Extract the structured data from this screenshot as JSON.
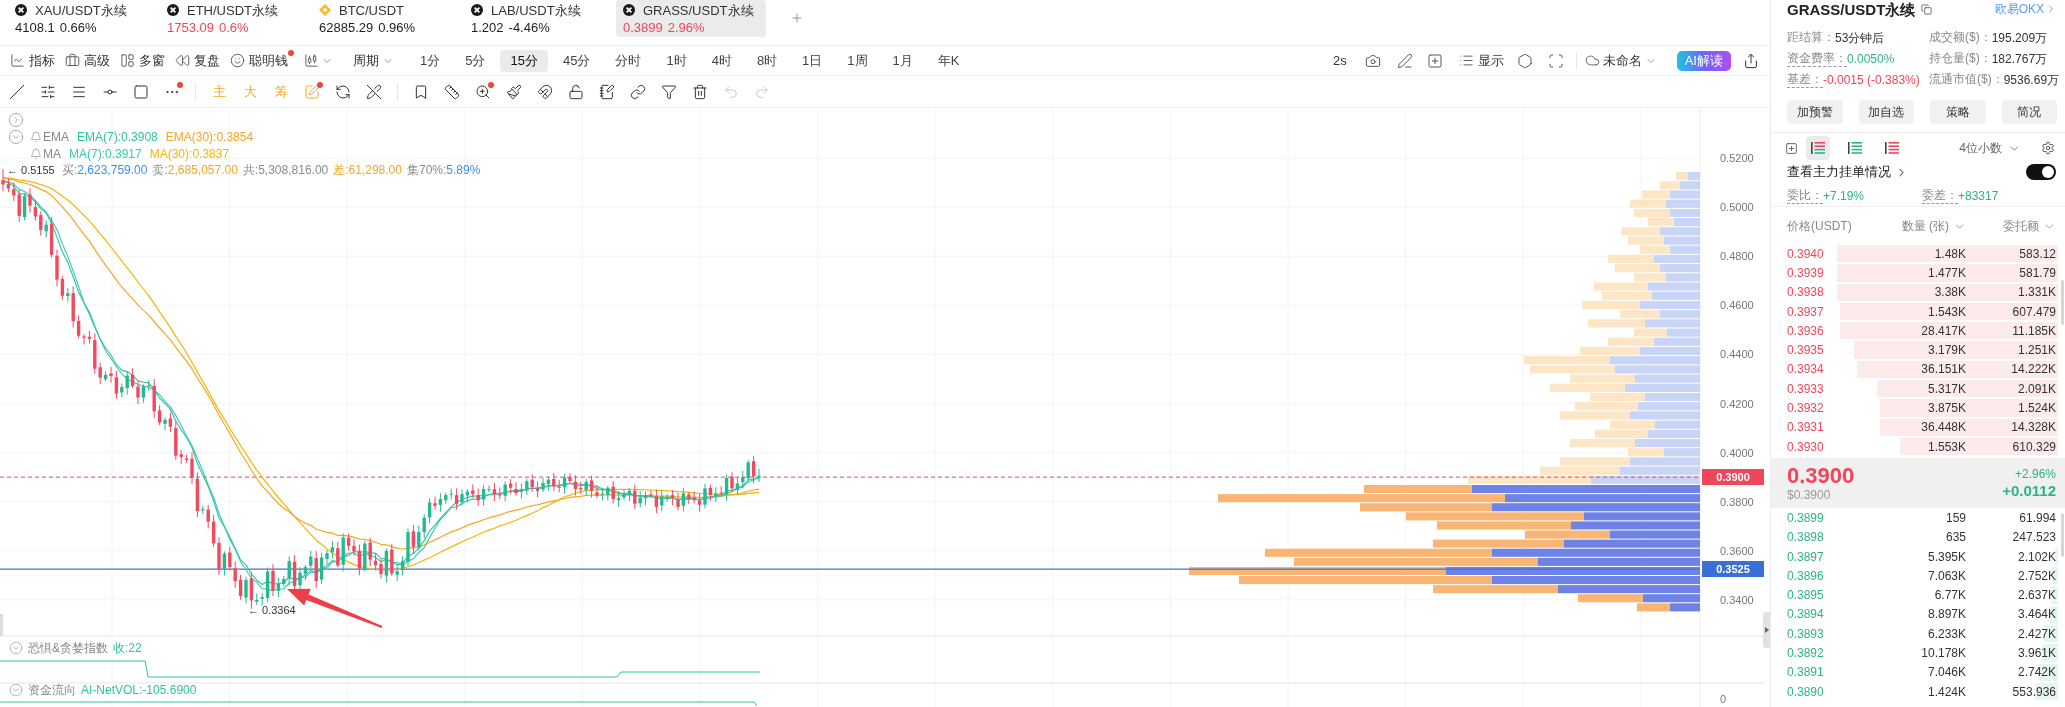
{
  "tabs": [
    {
      "symbol": "XAU/USDT永续",
      "price": "4108.1",
      "change": "0.66%",
      "kind": "cross",
      "color": "#1f1f1f",
      "selected": false
    },
    {
      "symbol": "ETH/USDT永续",
      "price": "1753.09",
      "change": "0.6%",
      "kind": "cross",
      "color": "#f0455a",
      "selected": false
    },
    {
      "symbol": "BTC/USDT",
      "price": "62885.29",
      "change": "0.96%",
      "kind": "diamond",
      "color": "#1f1f1f",
      "selected": false
    },
    {
      "symbol": "LAB/USDT永续",
      "price": "1.202",
      "change": "-4.46%",
      "kind": "cross",
      "color": "#1f1f1f",
      "selected": false
    },
    {
      "symbol": "GRASS/USDT永续",
      "price": "0.3899",
      "change": "2.96%",
      "kind": "cross",
      "color": "#f0455a",
      "selected": true
    }
  ],
  "toolbar": {
    "menus": [
      {
        "kind": "indicator",
        "label": "指标",
        "dot": false
      },
      {
        "kind": "advanced",
        "label": "高级",
        "dot": false
      },
      {
        "kind": "multi-window",
        "label": "多窗",
        "dot": false
      },
      {
        "kind": "replay",
        "label": "复盘",
        "dot": false
      },
      {
        "kind": "smart-money",
        "label": "聪明钱",
        "dot": true
      }
    ],
    "period": "周期",
    "intervals": [
      {
        "label": "1分",
        "selected": false
      },
      {
        "label": "5分",
        "selected": false
      },
      {
        "label": "15分",
        "selected": true
      },
      {
        "label": "45分",
        "selected": false
      },
      {
        "label": "分时",
        "selected": false
      },
      {
        "label": "1时",
        "selected": false
      },
      {
        "label": "4时",
        "selected": false
      },
      {
        "label": "8时",
        "selected": false
      },
      {
        "label": "1日",
        "selected": false
      },
      {
        "label": "1周",
        "selected": false
      },
      {
        "label": "1月",
        "selected": false
      },
      {
        "label": "年K",
        "selected": false
      }
    ],
    "refresh": "2s",
    "display": "显示",
    "layout": "未命名",
    "ai_button": "AI解读"
  },
  "drawing_tools": [
    {
      "tools": [
        {
          "kind": "trend-line",
          "dot": false,
          "disabled": false
        },
        {
          "kind": "parallel",
          "dot": false,
          "disabled": false
        },
        {
          "kind": "lines",
          "dot": false,
          "disabled": false
        },
        {
          "kind": "horizontal-line",
          "dot": false,
          "disabled": false
        },
        {
          "kind": "rectangle",
          "dot": false,
          "disabled": false
        },
        {
          "kind": "more",
          "dot": true,
          "disabled": false
        }
      ]
    },
    {
      "tools": [
        {
          "kind": "text",
          "label": "主",
          "dot": false,
          "disabled": false
        },
        {
          "kind": "text",
          "label": "大",
          "dot": false,
          "disabled": false
        },
        {
          "kind": "text",
          "label": "筹",
          "dot": false,
          "disabled": false
        },
        {
          "kind": "image-edit",
          "dot": true,
          "disabled": false
        },
        {
          "kind": "refresh",
          "dot": false,
          "disabled": false
        },
        {
          "kind": "pen-off",
          "dot": false,
          "disabled": false
        }
      ]
    },
    {
      "tools": [
        {
          "kind": "bookmark",
          "dot": false,
          "disabled": false
        },
        {
          "kind": "ruler",
          "dot": false,
          "disabled": false
        },
        {
          "kind": "zoom",
          "dot": true,
          "disabled": false
        },
        {
          "kind": "brush",
          "dot": false,
          "disabled": false
        },
        {
          "kind": "magnet",
          "dot": false,
          "disabled": false
        },
        {
          "kind": "lock",
          "dot": false,
          "disabled": false
        },
        {
          "kind": "note",
          "dot": false,
          "disabled": false
        },
        {
          "kind": "link",
          "dot": false,
          "disabled": false
        },
        {
          "kind": "filter",
          "dot": false,
          "disabled": false
        },
        {
          "kind": "trash",
          "dot": false,
          "disabled": false
        },
        {
          "kind": "undo",
          "dot": false,
          "disabled": true
        },
        {
          "kind": "redo",
          "dot": false,
          "disabled": true
        }
      ]
    }
  ],
  "legend": {
    "rows": [
      {
        "name": "EMA",
        "values": [
          {
            "text": "EMA(7):0.3908",
            "color": "#2ec4a0"
          },
          {
            "text": "EMA(30):0.3854",
            "color": "#f5a623"
          }
        ]
      },
      {
        "name": "MA",
        "values": [
          {
            "text": "MA(7):0.3917",
            "color": "#36c9b4"
          },
          {
            "text": "MA(30):0.3837",
            "color": "#f2b705"
          }
        ]
      }
    ],
    "order_flow": [
      {
        "parts": [
          {
            "text": "买:",
            "color": "#8a8a8a"
          },
          {
            "text": "2,623,759.00",
            "color": "#3d8ef0"
          }
        ]
      },
      {
        "parts": [
          {
            "text": "卖:",
            "color": "#8a8a8a"
          },
          {
            "text": "2,685,057.00",
            "color": "#f5a623"
          }
        ]
      },
      {
        "parts": [
          {
            "text": "共:5,308,816.00",
            "color": "#8a8a8a"
          }
        ]
      },
      {
        "parts": [
          {
            "text": "差:61,298.00",
            "color": "#f5a623"
          }
        ]
      },
      {
        "parts": [
          {
            "text": "集70%:",
            "color": "#8a8a8a"
          },
          {
            "text": "5.89%",
            "color": "#3d8ef0"
          }
        ]
      }
    ]
  },
  "chart": {
    "high_label": "← 0.5155",
    "low_label": "← 0.3364"
  },
  "price_axis": {
    "ticks": [
      "0.5200",
      "0.5000",
      "0.4800",
      "0.4600",
      "0.4400",
      "0.4200",
      "0.4000",
      "0.3800",
      "0.3600",
      "0.3400"
    ],
    "last_price": "0.3900",
    "marker_price": "0.3525",
    "pane_label": "0"
  },
  "panes": [
    {
      "name": "恐惧&贪婪指数",
      "reading": "收:22",
      "expanded": true
    },
    {
      "name": "资金流向",
      "reading": "AI-NetVOL:-105.6900",
      "expanded": true
    }
  ],
  "ticker": {
    "title": "GRASS/USDT永续",
    "exchange_link": "欧易OKX",
    "stats": [
      {
        "label": "距结算：",
        "value": "53分钟后",
        "color": "#333333",
        "dashed": false
      },
      {
        "label": "成交额($)：",
        "value": "195.209万",
        "color": "#333333",
        "dashed": false
      },
      {
        "label": "资金费率：",
        "value": "0.0050%",
        "color": "#2db389",
        "dashed": true
      },
      {
        "label": "持仓量($)：",
        "value": "182.767万",
        "color": "#333333",
        "dashed": false
      },
      {
        "label": "基差：",
        "value": "-0.0015 (-0.383%)",
        "color": "#f0455a",
        "dashed": true
      },
      {
        "label": "流通市值($)：",
        "value": "9536.69万",
        "color": "#333333",
        "dashed": false
      }
    ],
    "actions": [
      "加预警",
      "加自选",
      "策略",
      "简况"
    ]
  },
  "order_book": {
    "views": [
      {
        "kind": "both",
        "selected": true
      },
      {
        "kind": "bids",
        "selected": false
      },
      {
        "kind": "asks",
        "selected": false
      }
    ],
    "precision": "4位小数",
    "main_orders": {
      "label": "查看主力挂单情况",
      "on": true
    },
    "ratio": {
      "label": "委比：",
      "value": "+7.19%"
    },
    "difference": {
      "label": "委差：",
      "value": "+83317"
    },
    "columns": [
      {
        "label": "价格(USDT)",
        "sortable": false
      },
      {
        "label": "数量 (张)",
        "sortable": true
      },
      {
        "label": "委托额",
        "sortable": true
      }
    ],
    "asks": [
      {
        "price": "0.3940",
        "quantity": "1.48K",
        "amount": "583.12",
        "level": 0.78
      },
      {
        "price": "0.3939",
        "quantity": "1.477K",
        "amount": "581.79",
        "level": 0.78
      },
      {
        "price": "0.3938",
        "quantity": "3.38K",
        "amount": "1.331K",
        "level": 0.78
      },
      {
        "price": "0.3937",
        "quantity": "1.543K",
        "amount": "607.479",
        "level": 0.77
      },
      {
        "price": "0.3936",
        "quantity": "28.417K",
        "amount": "11.185K",
        "level": 0.77
      },
      {
        "price": "0.3935",
        "quantity": "3.179K",
        "amount": "1.251K",
        "level": 0.72
      },
      {
        "price": "0.3934",
        "quantity": "36.151K",
        "amount": "14.222K",
        "level": 0.71
      },
      {
        "price": "0.3933",
        "quantity": "5.317K",
        "amount": "2.091K",
        "level": 0.64
      },
      {
        "price": "0.3932",
        "quantity": "3.875K",
        "amount": "1.524K",
        "level": 0.63
      },
      {
        "price": "0.3931",
        "quantity": "36.448K",
        "amount": "14.328K",
        "level": 0.63
      },
      {
        "price": "0.3930",
        "quantity": "1.553K",
        "amount": "610.329",
        "level": 0.56
      }
    ],
    "last": {
      "price": "0.3900",
      "usd": "$0.3900",
      "change_pct": "+2.96%",
      "change": "+0.0112"
    },
    "bids": [
      {
        "price": "0.3899",
        "quantity": "159",
        "amount": "61.994"
      },
      {
        "price": "0.3898",
        "quantity": "635",
        "amount": "247.523"
      },
      {
        "price": "0.3897",
        "quantity": "5.395K",
        "amount": "2.102K",
        "level": 0.01
      },
      {
        "price": "0.3896",
        "quantity": "7.063K",
        "amount": "2.752K",
        "level": 0.02
      },
      {
        "price": "0.3895",
        "quantity": "6.77K",
        "amount": "2.637K",
        "level": 0.025
      },
      {
        "price": "0.3894",
        "quantity": "8.897K",
        "amount": "3.464K",
        "level": 0.03
      },
      {
        "price": "0.3893",
        "quantity": "6.233K",
        "amount": "2.427K",
        "level": 0.05
      },
      {
        "price": "0.3892",
        "quantity": "10.178K",
        "amount": "3.961K",
        "level": 0.055
      },
      {
        "price": "0.3891",
        "quantity": "7.046K",
        "amount": "2.742K",
        "level": 0.07
      },
      {
        "price": "0.3890",
        "quantity": "1.424K",
        "amount": "553.936",
        "level": 0.08
      }
    ]
  }
}
